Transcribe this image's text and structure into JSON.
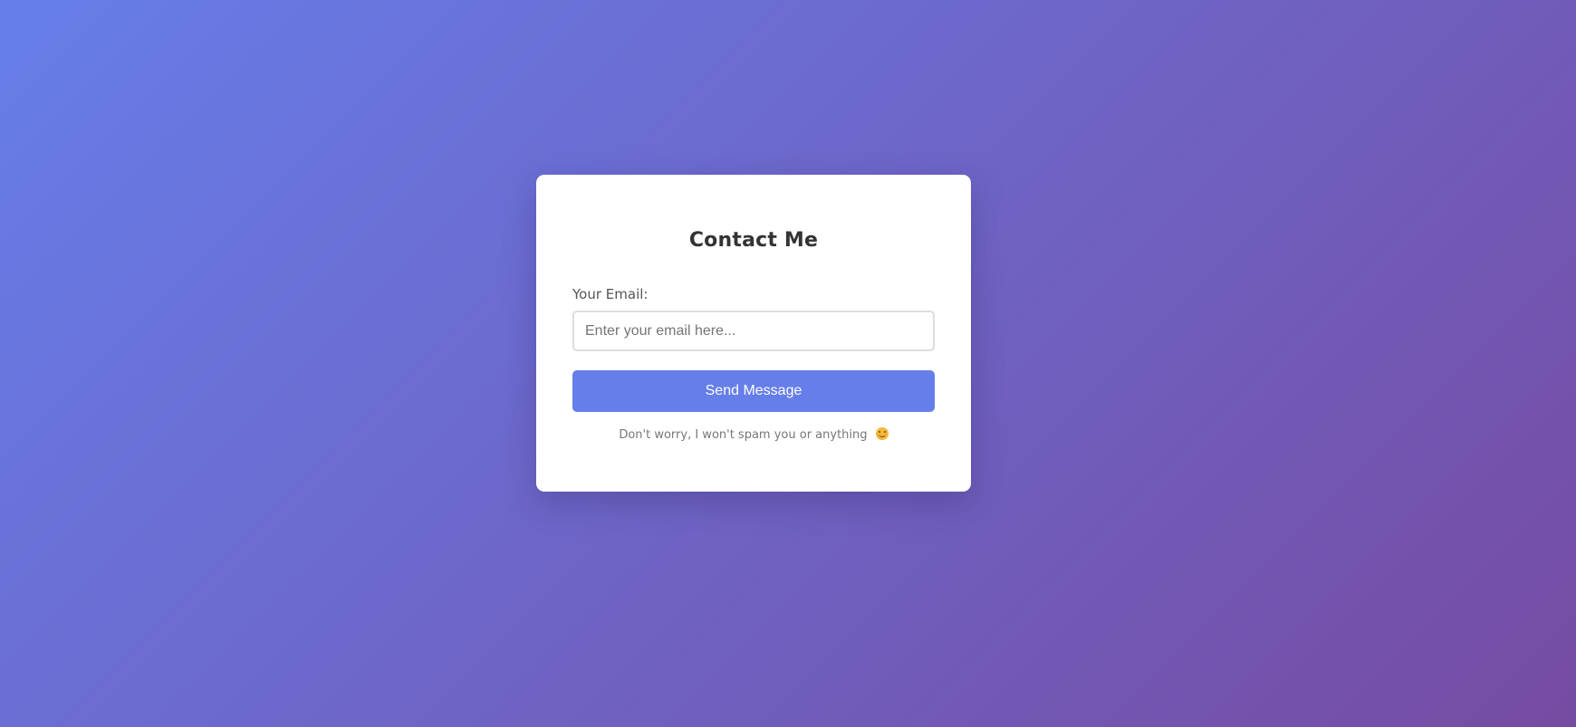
{
  "contact_form": {
    "title": "Contact Me",
    "email_label": "Your Email:",
    "email_value": "",
    "email_placeholder": "Enter your email here...",
    "submit_label": "Send Message",
    "note": "Don't worry, I won't spam you or anything",
    "note_icon": "smiling-face-icon"
  },
  "colors": {
    "background_start": "#667eea",
    "background_end": "#764ba2",
    "button": "#667eea",
    "card": "#ffffff"
  }
}
